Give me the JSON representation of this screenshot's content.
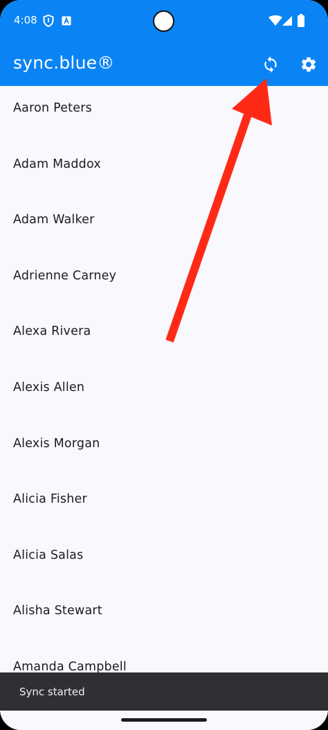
{
  "status_bar": {
    "time": "4:08",
    "icons": [
      "shield-icon",
      "a-badge-icon",
      "wifi-icon",
      "signal-icon",
      "battery-icon"
    ]
  },
  "app_bar": {
    "title": "sync.blue®",
    "actions": [
      "sync-icon",
      "settings-icon"
    ],
    "color": "#0a84f5"
  },
  "contacts": [
    "Aaron Peters",
    "Adam Maddox",
    "Adam Walker",
    "Adrienne Carney",
    "Alexa Rivera",
    "Alexis Allen",
    "Alexis Morgan",
    "Alicia Fisher",
    "Alicia Salas",
    "Alisha Stewart",
    "Amanda Campbell"
  ],
  "annotation": {
    "color": "#ff2a16",
    "points_to": "sync-icon"
  },
  "snackbar": {
    "message": "Sync started"
  }
}
